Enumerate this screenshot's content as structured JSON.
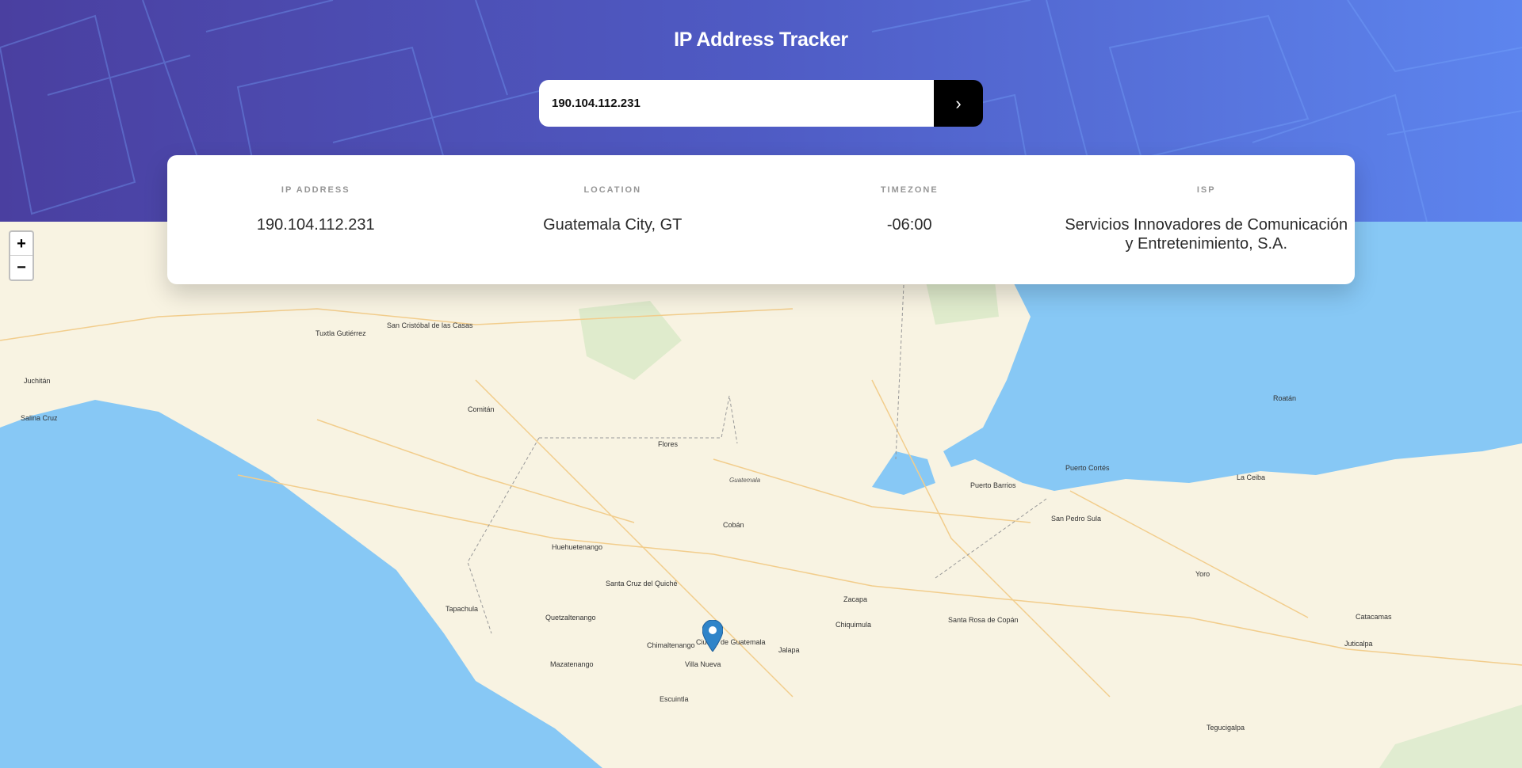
{
  "header": {
    "title": "IP Address Tracker"
  },
  "search": {
    "value": "190.104.112.231",
    "button_icon": "chevron-right-icon"
  },
  "info": [
    {
      "label": "IP ADDRESS",
      "value": "190.104.112.231"
    },
    {
      "label": "LOCATION",
      "value": "Guatemala City, GT"
    },
    {
      "label": "TIMEZONE",
      "value": "-06:00"
    },
    {
      "label": "ISP",
      "value": "Servicios Innovadores de Comunicación y Entretenimiento, S.A."
    }
  ],
  "map": {
    "zoom_in": "+",
    "zoom_out": "−",
    "labels": [
      "Tuxtla Gutiérrez",
      "San Cristóbal de las Casas",
      "Comitán",
      "Huehuetenango",
      "Quetzaltenango",
      "Cobán",
      "Guatemala",
      "Villa Nueva",
      "Escuintla",
      "Zacapa",
      "Jalapa",
      "Chiquimula",
      "San Pedro Sula",
      "Puerto Barrios",
      "La Ceiba",
      "Santa Rosa de Copán",
      "Tapachula",
      "Mazatenango",
      "Tegucigalpa",
      "Juticalpa",
      "Catacamas",
      "Yoro",
      "Roatán",
      "Chimaltenango",
      "Salina Cruz",
      "Juchitán",
      "Santa Cruz del Quiché",
      "Flores",
      "Puerto Cortés",
      "Ciudad de Guatemala"
    ]
  }
}
